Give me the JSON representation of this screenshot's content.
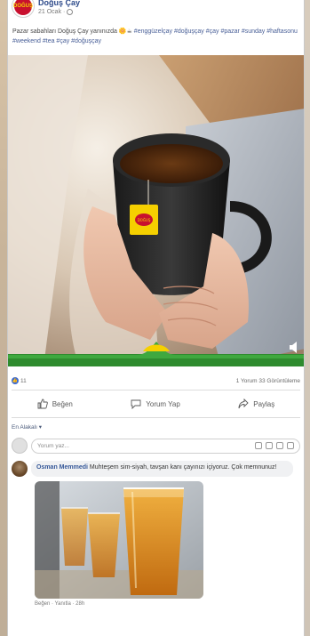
{
  "page": {
    "name": "Doğuş Çay",
    "avatar_text": "DOĞUŞ",
    "date": "21 Ocak ·"
  },
  "caption": {
    "text": "Pazar sabahları Doğuş Çay yanınızda 🌼☕",
    "hashtags": "#enggüzelçay #doğuşçay #çay #pazar #sunday #haftasonu #weekend #tea #çay #doğuşçay"
  },
  "stats": {
    "likes": "11",
    "comments_views": "1 Yorum  33 Görüntüleme"
  },
  "actions": {
    "like": "Beğen",
    "comment": "Yorum Yap",
    "share": "Paylaş"
  },
  "comment_filter": "En Alakalı ▾",
  "comment_input": {
    "placeholder": "Yorum yaz..."
  },
  "comments": [
    {
      "author": "Osman Memmedi",
      "text": "Muhteşem sim-siyah, tavşan kanı çayınızı içiyoruz. Çok memnunuz!",
      "footer": "Beğen · Yanıtla · 28h"
    }
  ],
  "colors": {
    "brand_red": "#c8102e",
    "brand_yellow": "#f5d000",
    "brand_green": "#2e8b2e",
    "link_blue": "#365899"
  }
}
